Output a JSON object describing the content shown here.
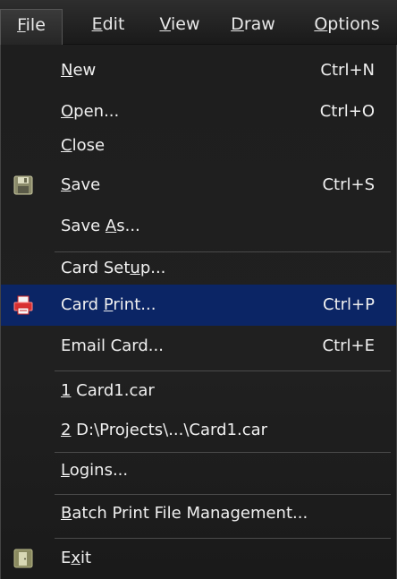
{
  "menubar": {
    "items": [
      {
        "pre": "",
        "u": "F",
        "post": "ile"
      },
      {
        "pre": "",
        "u": "E",
        "post": "dit"
      },
      {
        "pre": "",
        "u": "V",
        "post": "iew"
      },
      {
        "pre": "",
        "u": "D",
        "post": "raw"
      },
      {
        "pre": "",
        "u": "O",
        "post": "ptions"
      }
    ]
  },
  "file_menu": {
    "new": {
      "pre": "",
      "u": "N",
      "post": "ew",
      "shortcut": "Ctrl+N"
    },
    "open": {
      "pre": "",
      "u": "O",
      "post": "pen...",
      "shortcut": "Ctrl+O"
    },
    "close": {
      "pre": "",
      "u": "C",
      "post": "lose"
    },
    "save": {
      "pre": "",
      "u": "S",
      "post": "ave",
      "shortcut": "Ctrl+S"
    },
    "save_as": {
      "pre": "Save ",
      "u": "A",
      "post": "s..."
    },
    "card_setup": {
      "pre": "Card Set",
      "u": "u",
      "post": "p..."
    },
    "card_print": {
      "pre": "Card ",
      "u": "P",
      "post": "rint...",
      "shortcut": "Ctrl+P"
    },
    "email_card": {
      "pre": "Email Card...",
      "u": "",
      "post": "",
      "shortcut": "Ctrl+E"
    },
    "recent_1": {
      "pre": "",
      "u": "1",
      "post": " Card1.car"
    },
    "recent_2": {
      "pre": "",
      "u": "2",
      "post": " D:\\Projects\\...\\Card1.car"
    },
    "logins": {
      "pre": "",
      "u": "L",
      "post": "ogins..."
    },
    "batch_print": {
      "pre": "",
      "u": "B",
      "post": "atch Print File Management..."
    },
    "exit": {
      "pre": "E",
      "u": "x",
      "post": "it"
    }
  },
  "icons": {
    "save": "floppy-disk-icon",
    "card_print": "printer-icon",
    "exit": "exit-door-icon"
  },
  "colors": {
    "menu_bg": "#1e1e1e",
    "highlight": "#0b2565",
    "text": "#f0f0f0",
    "separator": "#4a4a4a"
  }
}
